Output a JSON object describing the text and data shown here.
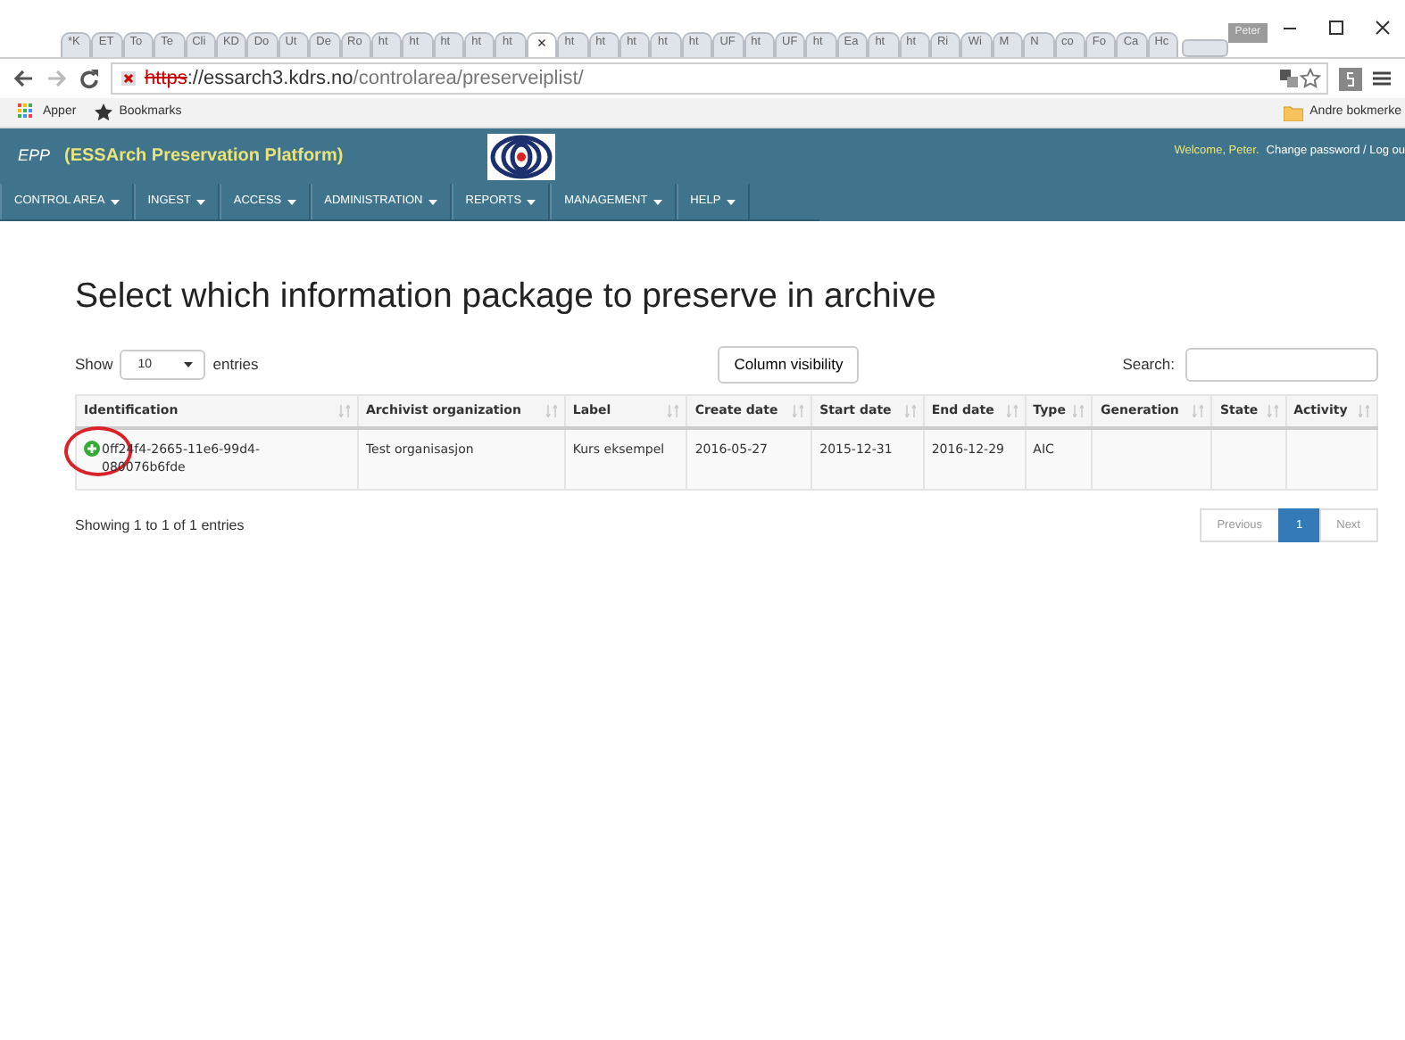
{
  "browser": {
    "tabs": [
      {
        "label": "*K",
        "selected": false
      },
      {
        "label": "ET",
        "selected": false
      },
      {
        "label": "To",
        "selected": false
      },
      {
        "label": "Te",
        "selected": false
      },
      {
        "label": "Cli",
        "selected": false
      },
      {
        "label": "KD",
        "selected": false
      },
      {
        "label": "Do",
        "selected": false
      },
      {
        "label": "Ut",
        "selected": false
      },
      {
        "label": "De",
        "selected": false
      },
      {
        "label": "Ro",
        "selected": false
      },
      {
        "label": "ht",
        "selected": false
      },
      {
        "label": "ht",
        "selected": false
      },
      {
        "label": "ht",
        "selected": false
      },
      {
        "label": "ht",
        "selected": false
      },
      {
        "label": "ht",
        "selected": false
      },
      {
        "label": "×",
        "selected": true
      },
      {
        "label": "ht",
        "selected": false
      },
      {
        "label": "ht",
        "selected": false
      },
      {
        "label": "ht",
        "selected": false
      },
      {
        "label": "ht",
        "selected": false
      },
      {
        "label": "ht",
        "selected": false
      },
      {
        "label": "UF",
        "selected": false
      },
      {
        "label": "ht",
        "selected": false
      },
      {
        "label": "UF",
        "selected": false
      },
      {
        "label": "ht",
        "selected": false
      },
      {
        "label": "Ea",
        "selected": false
      },
      {
        "label": "ht",
        "selected": false
      },
      {
        "label": "ht",
        "selected": false
      },
      {
        "label": "Ri",
        "selected": false
      },
      {
        "label": "Wi",
        "selected": false
      },
      {
        "label": "M",
        "selected": false
      },
      {
        "label": "N",
        "selected": false
      },
      {
        "label": "co",
        "selected": false
      },
      {
        "label": "Fo",
        "selected": false
      },
      {
        "label": "Ca",
        "selected": false
      },
      {
        "label": "Hc",
        "selected": false
      }
    ],
    "profile": "Peter",
    "url_scheme": "https",
    "url_host": "://essarch3.kdrs.no",
    "url_path": "/controlarea/preserveiplist/",
    "bookmarks": [
      "Apper",
      "Bookmarks"
    ],
    "other_bookmarks": "Andre bokmerke"
  },
  "app": {
    "brand_short": "EPP",
    "brand_long": "(ESSArch Preservation Platform)",
    "welcome": "Welcome, Peter.",
    "account_links": "Change password / Log ou",
    "menu": [
      "CONTROL AREA",
      "INGEST",
      "ACCESS",
      "ADMINISTRATION",
      "REPORTS",
      "MANAGEMENT",
      "HELP"
    ]
  },
  "page": {
    "title": "Select which information package to preserve in archive",
    "show_label": "Show",
    "page_size": "10",
    "entries_label": "entries",
    "column_visibility": "Column visibility",
    "search_label": "Search:",
    "table": {
      "columns": [
        "Identification",
        "Archivist organization",
        "Label",
        "Create date",
        "Start date",
        "End date",
        "Type",
        "Generation",
        "State",
        "Activity"
      ],
      "rows": [
        {
          "cells": [
            "0ff24f4-2665-11e6-99d4-080076b6fde",
            "Test organisasjon",
            "Kurs eksempel",
            "2016-05-27",
            "2015-12-31",
            "2016-12-29",
            "AIC",
            "",
            "",
            ""
          ],
          "expanded": false
        }
      ]
    },
    "info": "Showing 1 to 1 of 1 entries",
    "pagination": [
      {
        "label": "Previous",
        "selected": false
      },
      {
        "label": "1",
        "selected": true
      },
      {
        "label": "Next",
        "selected": false
      }
    ]
  }
}
